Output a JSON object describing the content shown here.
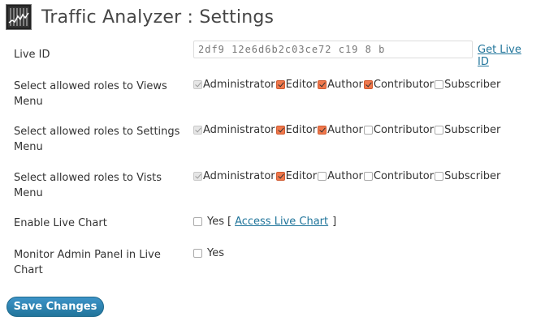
{
  "page": {
    "title": "Traffic Analyzer : Settings"
  },
  "live_id": {
    "label": "Live ID",
    "value": "2df9 12e6d6b2c03ce72 c19 8 b",
    "get_link": "Get Live ID"
  },
  "role_rows": [
    {
      "label": "Select allowed roles to Views Menu",
      "roles": [
        {
          "name": "Administrator",
          "checked": true,
          "disabled": true
        },
        {
          "name": "Editor",
          "checked": true,
          "disabled": false
        },
        {
          "name": "Author",
          "checked": true,
          "disabled": false
        },
        {
          "name": "Contributor",
          "checked": true,
          "disabled": false
        },
        {
          "name": "Subscriber",
          "checked": false,
          "disabled": false
        }
      ]
    },
    {
      "label": "Select allowed roles to Settings Menu",
      "roles": [
        {
          "name": "Administrator",
          "checked": true,
          "disabled": true
        },
        {
          "name": "Editor",
          "checked": true,
          "disabled": false
        },
        {
          "name": "Author",
          "checked": true,
          "disabled": false
        },
        {
          "name": "Contributor",
          "checked": false,
          "disabled": false
        },
        {
          "name": "Subscriber",
          "checked": false,
          "disabled": false
        }
      ]
    },
    {
      "label": "Select allowed roles to Vists Menu",
      "roles": [
        {
          "name": "Administrator",
          "checked": true,
          "disabled": true
        },
        {
          "name": "Editor",
          "checked": true,
          "disabled": false
        },
        {
          "name": "Author",
          "checked": false,
          "disabled": false
        },
        {
          "name": "Contributor",
          "checked": false,
          "disabled": false
        },
        {
          "name": "Subscriber",
          "checked": false,
          "disabled": false
        }
      ]
    }
  ],
  "live_chart": {
    "label": "Enable Live Chart",
    "yes": "Yes",
    "bracket_open": "[",
    "link": "Access Live Chart",
    "bracket_close": "]",
    "checked": false
  },
  "monitor_admin": {
    "label": "Monitor Admin Panel in Live Chart",
    "yes": "Yes",
    "checked": false
  },
  "save_label": "Save Changes",
  "colors": {
    "accent": "#21759b",
    "checkbox_checked": "#f0784c"
  }
}
